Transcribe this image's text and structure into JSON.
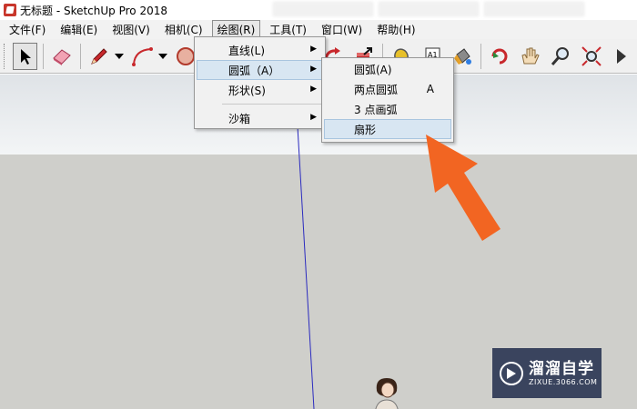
{
  "window": {
    "title": "无标题 - SketchUp Pro 2018"
  },
  "menubar": {
    "items": [
      {
        "label": "文件(F)"
      },
      {
        "label": "编辑(E)"
      },
      {
        "label": "视图(V)"
      },
      {
        "label": "相机(C)"
      },
      {
        "label": "绘图(R)"
      },
      {
        "label": "工具(T)"
      },
      {
        "label": "窗口(W)"
      },
      {
        "label": "帮助(H)"
      }
    ],
    "active": "绘图(R)"
  },
  "toolbar": {
    "tools": [
      "select-icon",
      "eraser-icon",
      "pencil-icon",
      "arc-tool-icon",
      "circle-icon",
      "follow-me-icon",
      "push-pull-icon",
      "tape-measure-icon",
      "text-icon",
      "paint-bucket-icon",
      "orbit-icon",
      "pan-icon",
      "zoom-icon",
      "zoom-extents-icon",
      "next-icon"
    ]
  },
  "draw_menu": {
    "items": [
      {
        "label": "直线(L)",
        "has_submenu": true
      },
      {
        "label": "圆弧（A）",
        "has_submenu": true
      },
      {
        "label": "形状(S)",
        "has_submenu": true
      },
      {
        "label": "沙箱",
        "has_submenu": true
      }
    ],
    "highlighted": "圆弧（A）"
  },
  "arc_submenu": {
    "items": [
      {
        "label": "圆弧(A)",
        "shortcut": ""
      },
      {
        "label": "两点圆弧",
        "shortcut": "A"
      },
      {
        "label": "3 点画弧",
        "shortcut": ""
      },
      {
        "label": "扇形",
        "shortcut": ""
      }
    ],
    "highlighted": "扇形"
  },
  "watermark": {
    "title": "溜溜自学",
    "subtitle": "ZIXUE.3066.COM"
  },
  "colors": {
    "accent_arrow": "#f26522",
    "menu_highlight": "#d8e6f2",
    "sky": "#e7eaed",
    "ground": "#cfcfcb",
    "axis_blue": "#2b2bbf"
  }
}
